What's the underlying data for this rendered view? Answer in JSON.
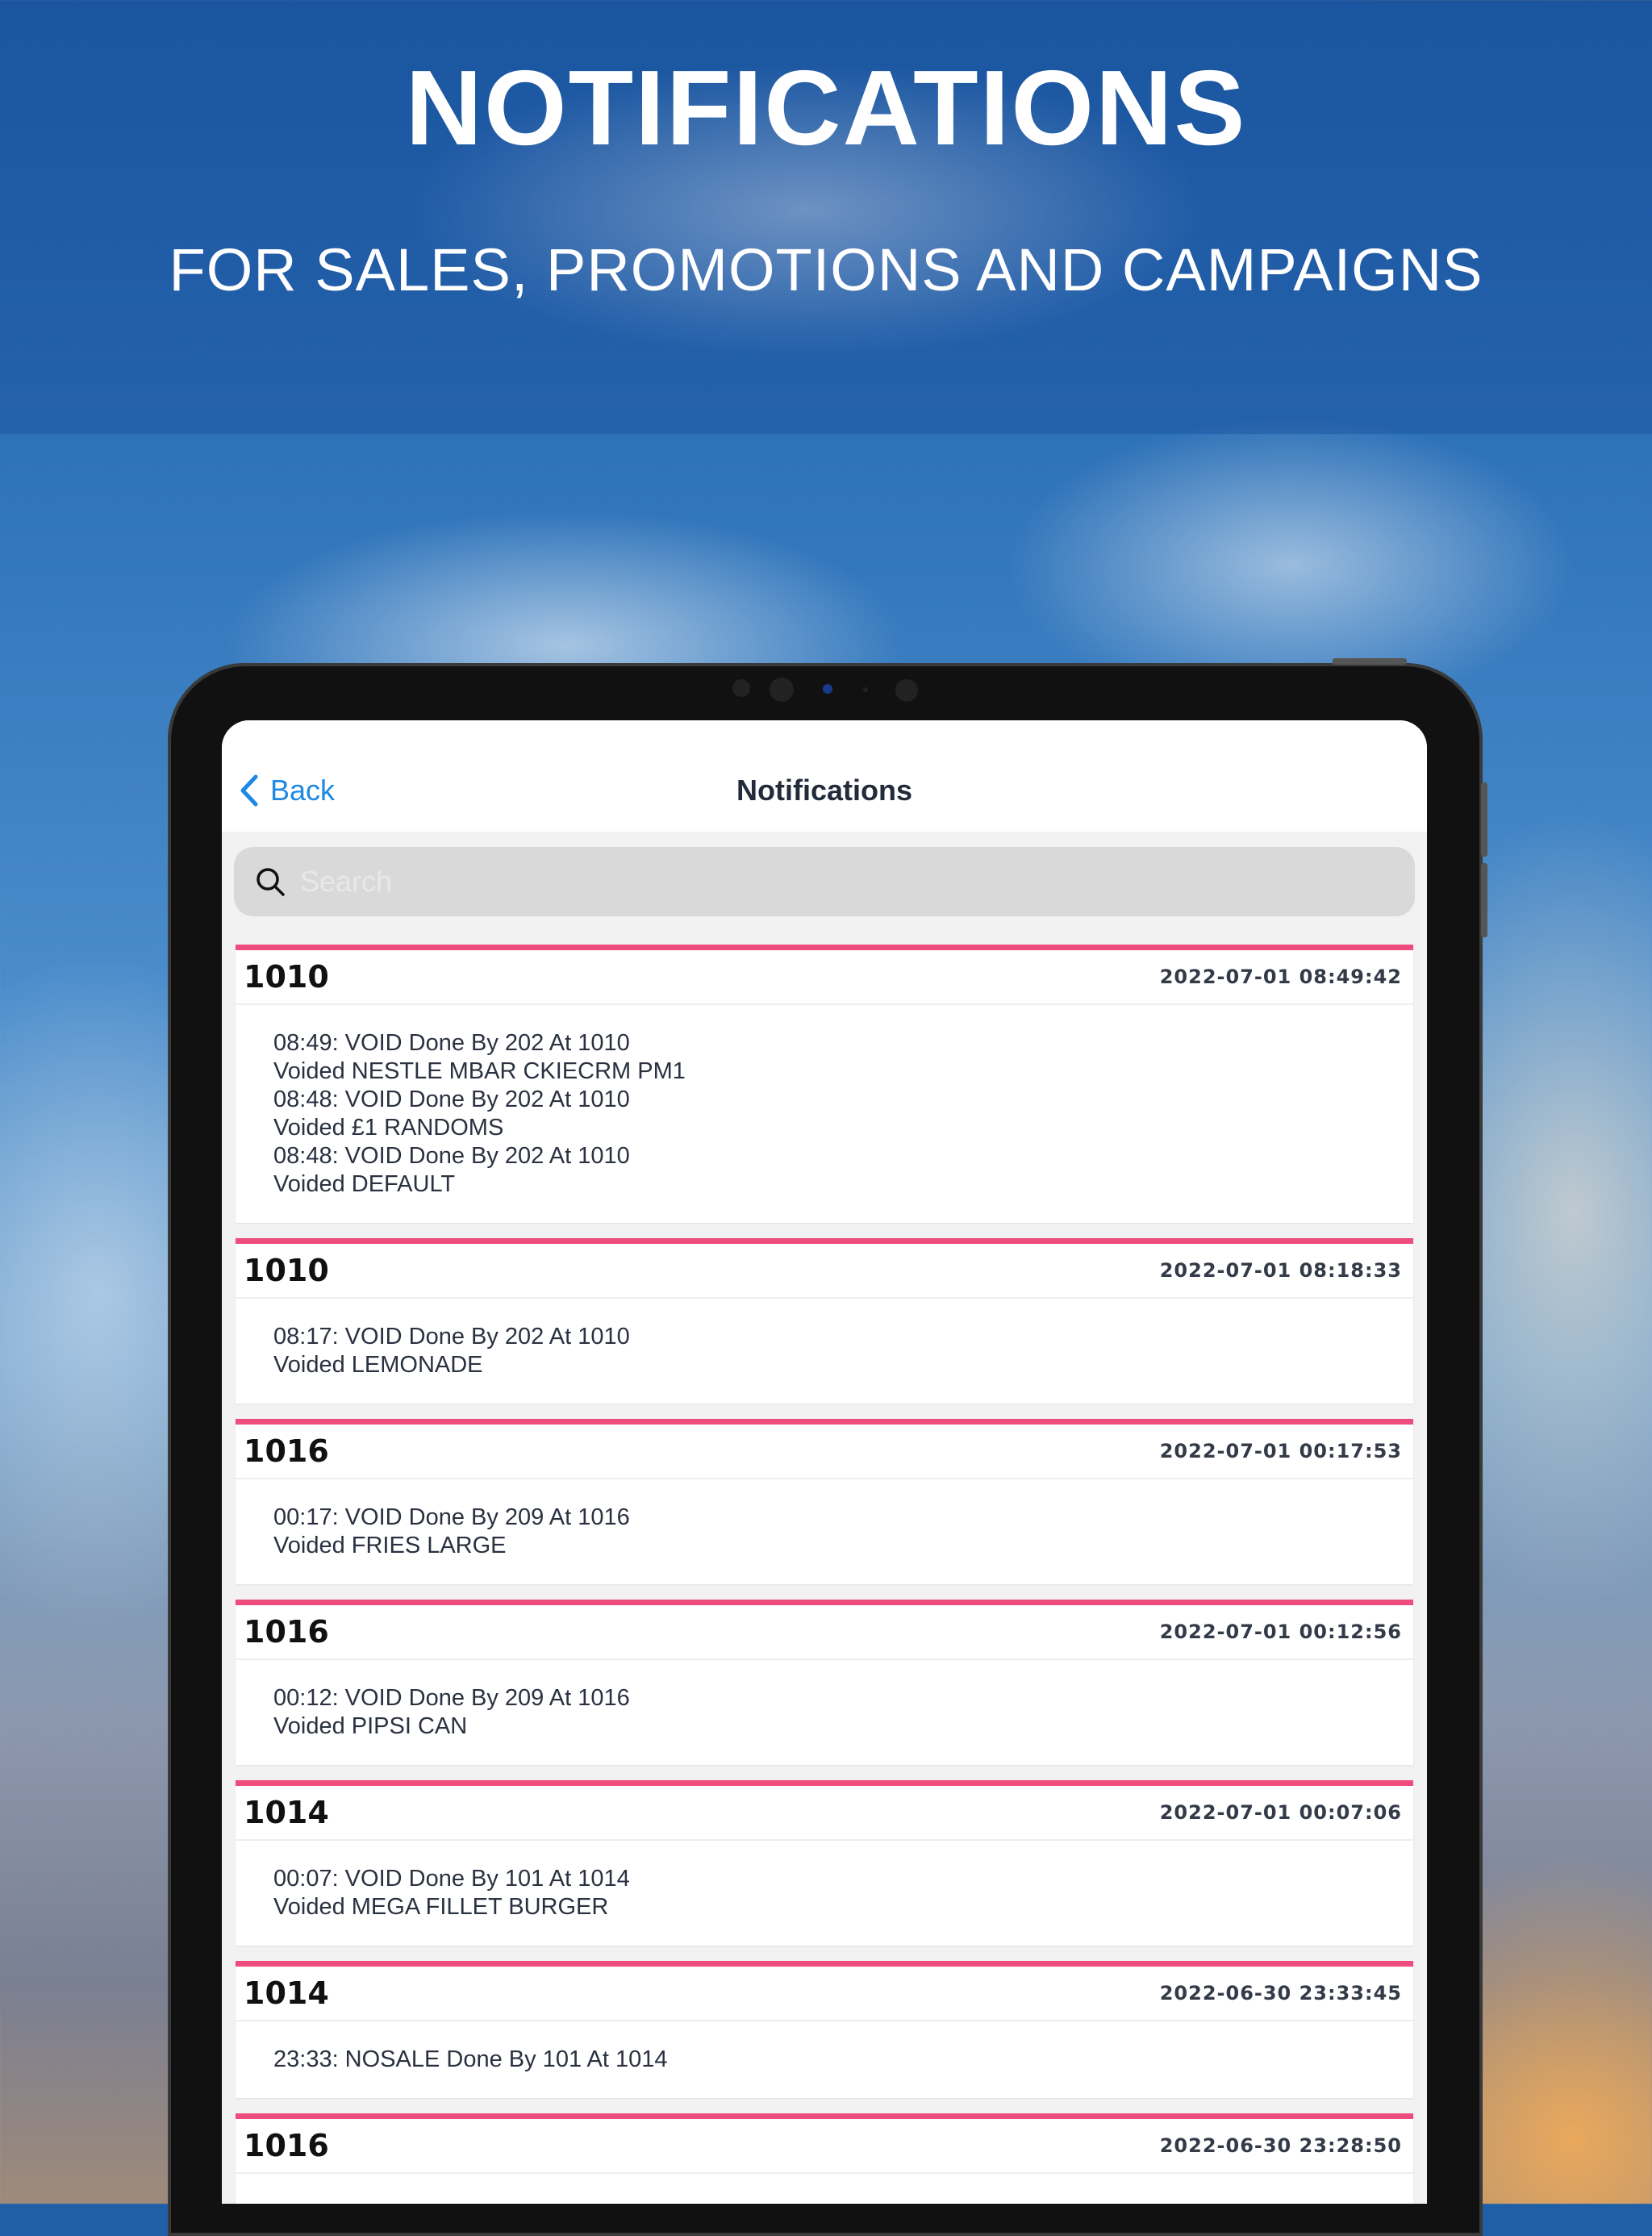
{
  "hero": {
    "title": "NOTIFICATIONS",
    "subtitle": "FOR SALES, PROMOTIONS AND CAMPAIGNS"
  },
  "navbar": {
    "back_label": "Back",
    "title": "Notifications"
  },
  "search": {
    "placeholder": "Search",
    "value": ""
  },
  "notifications": [
    {
      "id": "1010",
      "timestamp": "2022-07-01 08:49:42",
      "lines": [
        "08:49: VOID Done By 202 At 1010",
        "Voided NESTLE MBAR CKIECRM PM1",
        "08:48: VOID Done By 202 At 1010",
        "Voided £1 RANDOMS",
        "08:48: VOID Done By 202 At 1010",
        "Voided DEFAULT"
      ]
    },
    {
      "id": "1010",
      "timestamp": "2022-07-01 08:18:33",
      "lines": [
        "08:17: VOID Done By 202 At 1010",
        "Voided LEMONADE"
      ]
    },
    {
      "id": "1016",
      "timestamp": "2022-07-01 00:17:53",
      "lines": [
        "00:17: VOID Done By 209 At 1016",
        "Voided FRIES LARGE"
      ]
    },
    {
      "id": "1016",
      "timestamp": "2022-07-01 00:12:56",
      "lines": [
        "00:12: VOID Done By 209 At 1016",
        "Voided PIPSI CAN"
      ]
    },
    {
      "id": "1014",
      "timestamp": "2022-07-01 00:07:06",
      "lines": [
        "00:07: VOID Done By 101 At 1014",
        "Voided MEGA FILLET BURGER"
      ]
    },
    {
      "id": "1014",
      "timestamp": "2022-06-30 23:33:45",
      "lines": [
        "23:33: NOSALE Done By 101 At 1014"
      ]
    },
    {
      "id": "1016",
      "timestamp": "2022-06-30 23:28:50",
      "lines": []
    }
  ],
  "colors": {
    "accent": "#ee4c7c",
    "link": "#1e88e5"
  },
  "icons": {
    "back": "chevron-left-icon",
    "search": "search-icon"
  }
}
